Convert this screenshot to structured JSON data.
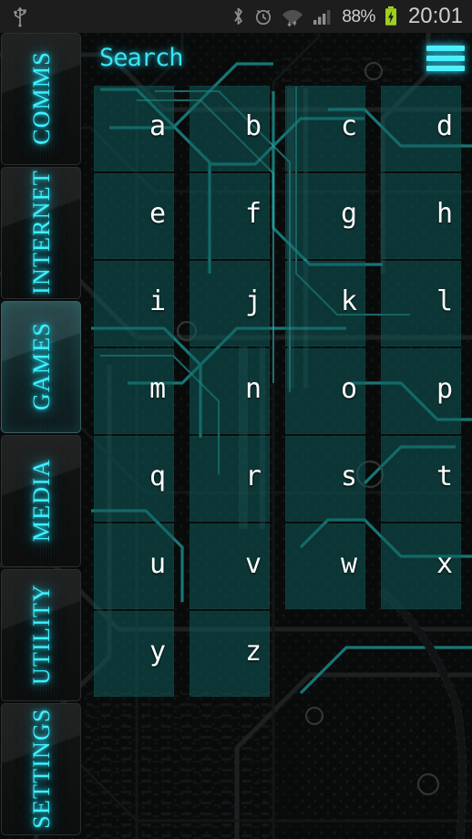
{
  "statusbar": {
    "left_icons": [
      {
        "name": "usb-icon",
        "glyph": "usb"
      }
    ],
    "right_icons": [
      {
        "name": "bluetooth-icon",
        "glyph": "bluetooth"
      },
      {
        "name": "alarm-icon",
        "glyph": "alarm"
      },
      {
        "name": "wifi-icon",
        "glyph": "wifi"
      },
      {
        "name": "signal-icon",
        "glyph": "signal"
      }
    ],
    "battery_percent": "88%",
    "battery_charging": true,
    "battery_color": "#9ed020",
    "clock": "20:01"
  },
  "sidebar": {
    "items": [
      {
        "label": "COMMS",
        "active": false
      },
      {
        "label": "INTERNET",
        "active": false
      },
      {
        "label": "GAMES",
        "active": true
      },
      {
        "label": "MEDIA",
        "active": false
      },
      {
        "label": "UTILITY",
        "active": false
      },
      {
        "label": "SETTINGS",
        "active": false
      }
    ],
    "label_color": "#3ff0ff"
  },
  "header": {
    "title": "Search",
    "title_color": "#39e4f4",
    "menu_icon": "hamburger-menu-icon",
    "menu_color": "#4ef2ff"
  },
  "letter_grid": {
    "tile_color": "#105d5c",
    "letter_color": "#ffffff",
    "rows": [
      [
        "a",
        "b",
        "c",
        "d"
      ],
      [
        "e",
        "f",
        "g",
        "h"
      ],
      [
        "i",
        "j",
        "k",
        "l"
      ],
      [
        "m",
        "n",
        "o",
        "p"
      ],
      [
        "q",
        "r",
        "s",
        "t"
      ],
      [
        "u",
        "v",
        "w",
        "x"
      ],
      [
        "y",
        "z",
        "",
        ""
      ]
    ]
  },
  "theme": {
    "background": "#080a0a",
    "accent": "#3ff0ff",
    "statusbar_bg": "#1d1d1d"
  }
}
